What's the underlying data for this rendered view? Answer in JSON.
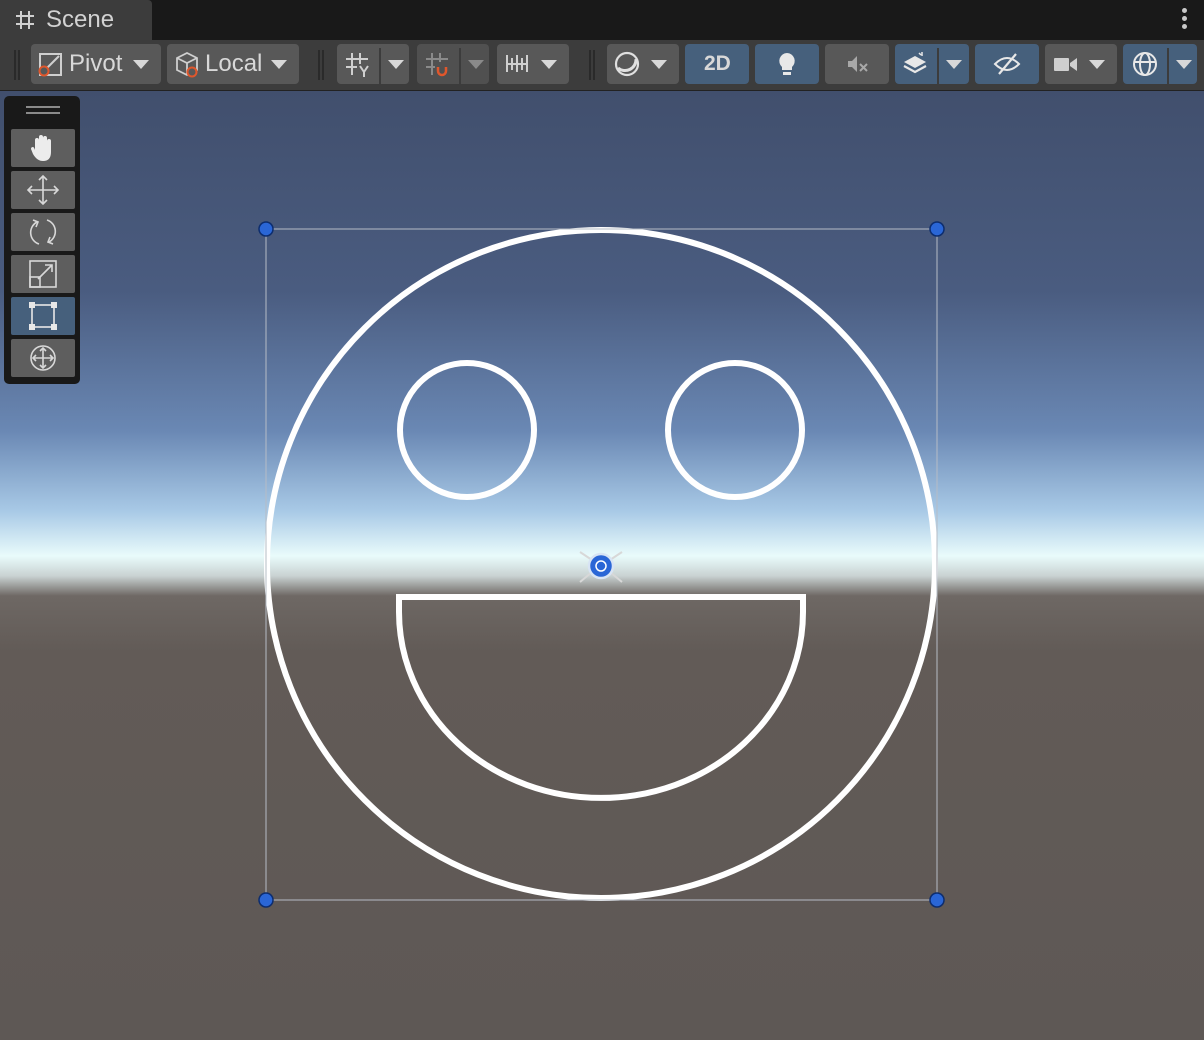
{
  "tab": {
    "title": "Scene",
    "icon": "hash-icon"
  },
  "toolbar": {
    "pivot_label": "Pivot",
    "local_label": "Local",
    "mode_2d_label": "2D",
    "icons": [
      "grid-snap-icon",
      "increment-snap-icon",
      "ruler-icon",
      "shading-mode-icon",
      "lighting-icon",
      "audio-mute-icon",
      "effects-icon",
      "hidden-objects-icon",
      "camera-icon",
      "gizmos-icon"
    ]
  },
  "tools": [
    {
      "name": "hand-tool",
      "active": false
    },
    {
      "name": "move-tool",
      "active": false
    },
    {
      "name": "rotate-tool",
      "active": false
    },
    {
      "name": "scale-tool",
      "active": false
    },
    {
      "name": "rect-tool",
      "active": true
    },
    {
      "name": "transform-tool",
      "active": false
    }
  ],
  "colors": {
    "accent": "#46607c",
    "handle": "#2a66d6",
    "sky_top": "#414f6d",
    "horizon": "#e9fbfb",
    "ground": "#5e5855"
  }
}
